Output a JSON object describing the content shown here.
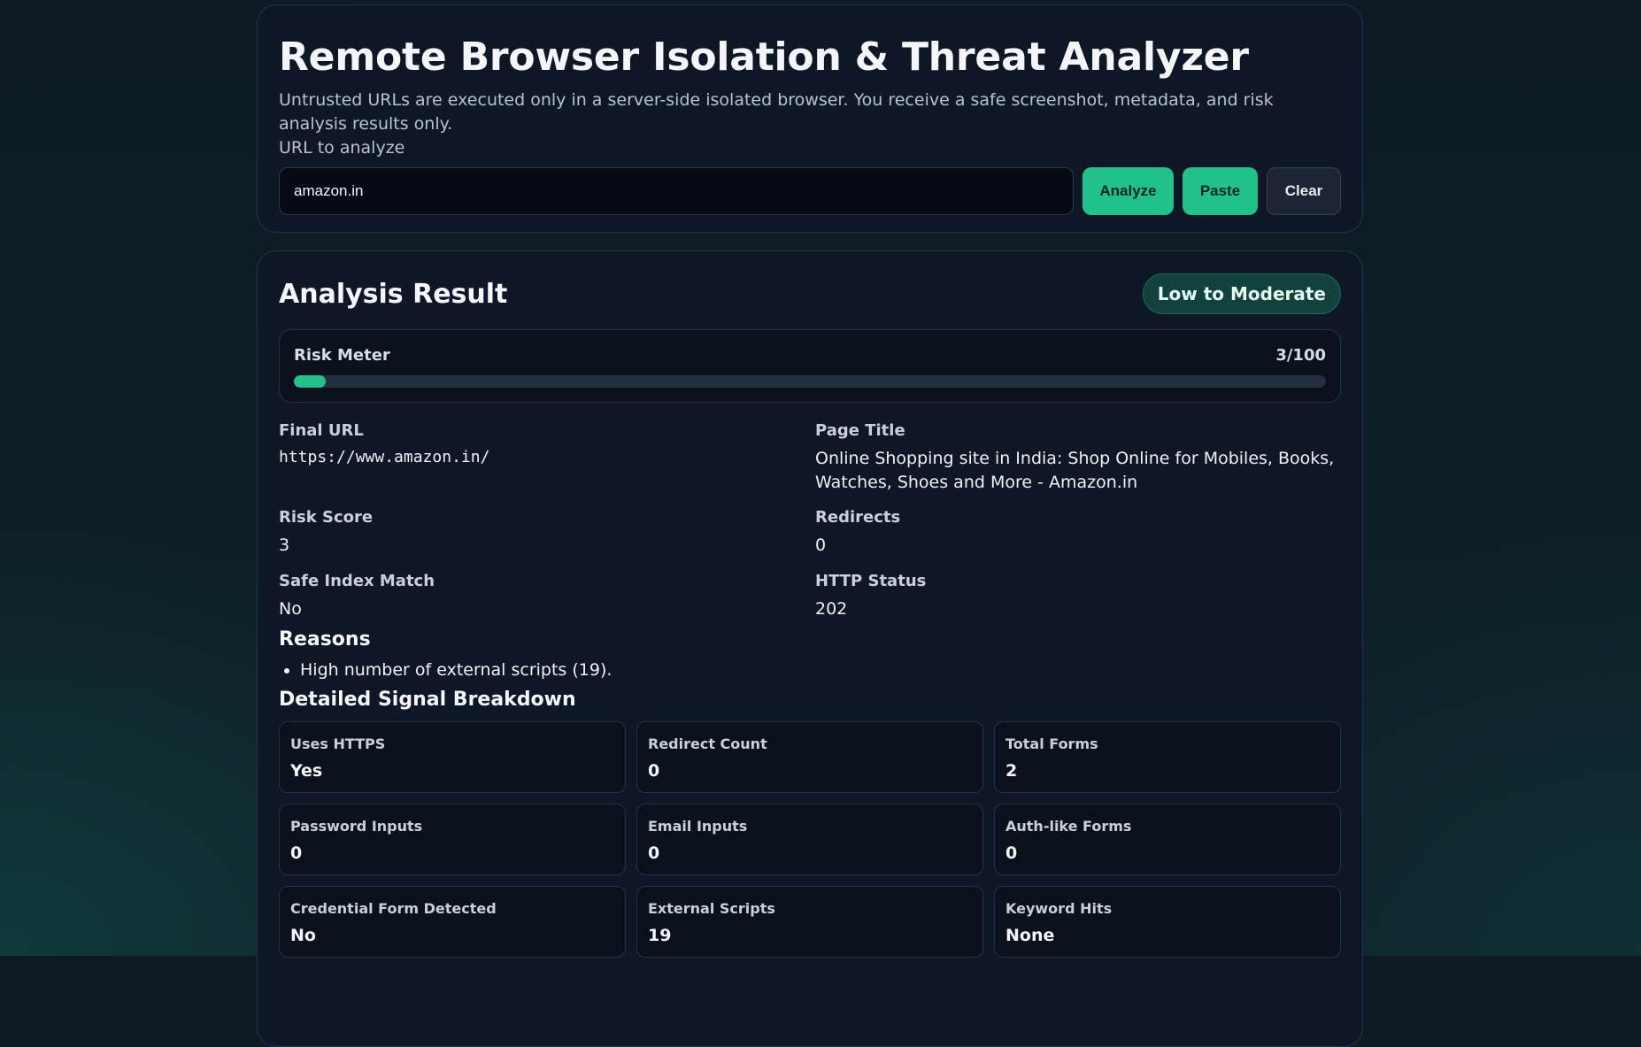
{
  "header": {
    "title": "Remote Browser Isolation & Threat Analyzer",
    "subtitle": "Untrusted URLs are executed only in a server-side isolated browser. You receive a safe screenshot, metadata, and risk analysis results only.",
    "url_label": "URL to analyze",
    "url_value": "amazon.in",
    "buttons": {
      "analyze": "Analyze",
      "paste": "Paste",
      "clear": "Clear"
    }
  },
  "result": {
    "title": "Analysis Result",
    "risk_level": "Low to Moderate",
    "meter": {
      "label": "Risk Meter",
      "value_text": "3/100",
      "score": 3,
      "max": 100
    },
    "fields": {
      "final_url_label": "Final URL",
      "final_url": "https://www.amazon.in/",
      "page_title_label": "Page Title",
      "page_title": "Online Shopping site in India: Shop Online for Mobiles, Books, Watches, Shoes and More - Amazon.in",
      "risk_score_label": "Risk Score",
      "risk_score": "3",
      "redirects_label": "Redirects",
      "redirects": "0",
      "safe_index_label": "Safe Index Match",
      "safe_index": "No",
      "http_status_label": "HTTP Status",
      "http_status": "202"
    },
    "reasons_title": "Reasons",
    "reasons": [
      "High number of external scripts (19)."
    ],
    "breakdown_title": "Detailed Signal Breakdown",
    "signals": [
      {
        "label": "Uses HTTPS",
        "value": "Yes"
      },
      {
        "label": "Redirect Count",
        "value": "0"
      },
      {
        "label": "Total Forms",
        "value": "2"
      },
      {
        "label": "Password Inputs",
        "value": "0"
      },
      {
        "label": "Email Inputs",
        "value": "0"
      },
      {
        "label": "Auth-like Forms",
        "value": "0"
      },
      {
        "label": "Credential Form Detected",
        "value": "No"
      },
      {
        "label": "External Scripts",
        "value": "19"
      },
      {
        "label": "Keyword Hits",
        "value": "None"
      }
    ]
  },
  "colors": {
    "accent": "#22c08a",
    "card_bg": "#0e1726",
    "badge_bg": "#13413b"
  }
}
